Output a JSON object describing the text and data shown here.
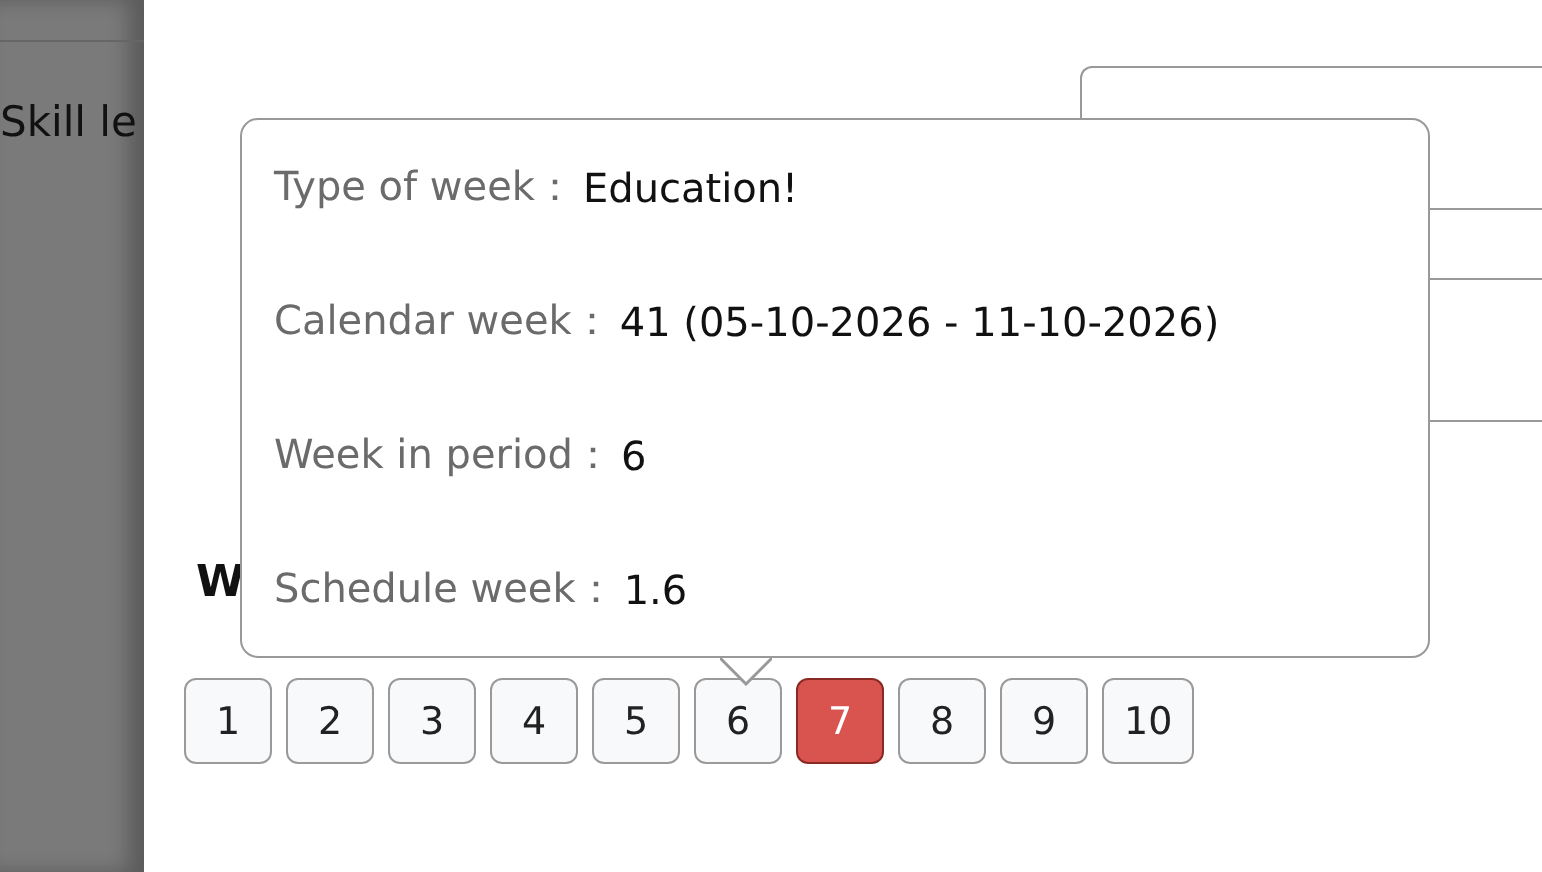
{
  "background_panel": {
    "text": "Skill le"
  },
  "drawer": {
    "heading": "W",
    "week_buttons": [
      {
        "label": "1",
        "selected": false
      },
      {
        "label": "2",
        "selected": false
      },
      {
        "label": "3",
        "selected": false
      },
      {
        "label": "4",
        "selected": false
      },
      {
        "label": "5",
        "selected": false
      },
      {
        "label": "6",
        "selected": false
      },
      {
        "label": "7",
        "selected": true
      },
      {
        "label": "8",
        "selected": false
      },
      {
        "label": "9",
        "selected": false
      },
      {
        "label": "10",
        "selected": false
      }
    ]
  },
  "tooltip": {
    "rows": [
      {
        "label": "Type of week：",
        "value": "Education!"
      },
      {
        "label": "Calendar week：",
        "value": "41 (05-10-2026 - 11-10-2026)"
      },
      {
        "label": "Week in period：",
        "value": "6"
      },
      {
        "label": "Schedule week：",
        "value": "1.6"
      }
    ]
  }
}
